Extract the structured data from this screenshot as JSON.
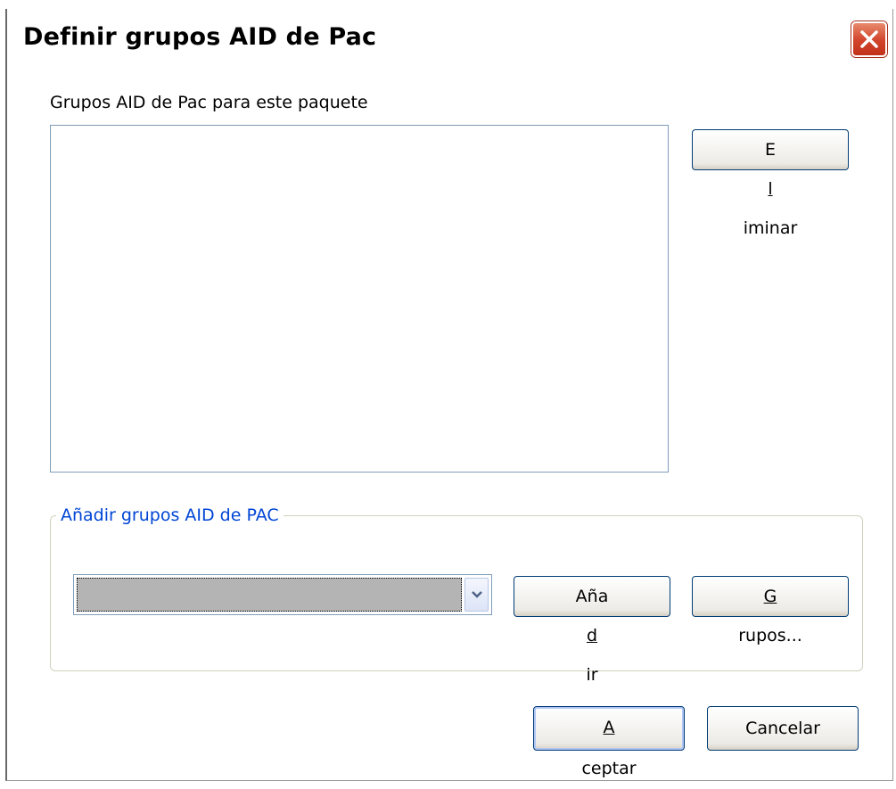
{
  "window": {
    "title": "Definir grupos AID de Pac",
    "close_icon": "close-icon"
  },
  "groups_list": {
    "label": "Grupos AID de Pac para este paquete",
    "items": []
  },
  "buttons": {
    "eliminar": {
      "pre": "E",
      "key": "l",
      "post": "iminar"
    },
    "anadir": {
      "pre": "Aña",
      "key": "d",
      "post": "ir"
    },
    "grupos": {
      "pre": "",
      "key": "G",
      "post": "rupos..."
    },
    "aceptar": {
      "pre": "",
      "key": "A",
      "post": "ceptar"
    },
    "cancelar": {
      "pre": "Cancelar",
      "key": "",
      "post": ""
    }
  },
  "add_group": {
    "legend": "Añadir grupos AID de PAC",
    "selected_value": ""
  },
  "colors": {
    "close_button": "#d1432a",
    "legend_text": "#0046d5",
    "button_border": "#003c74"
  }
}
